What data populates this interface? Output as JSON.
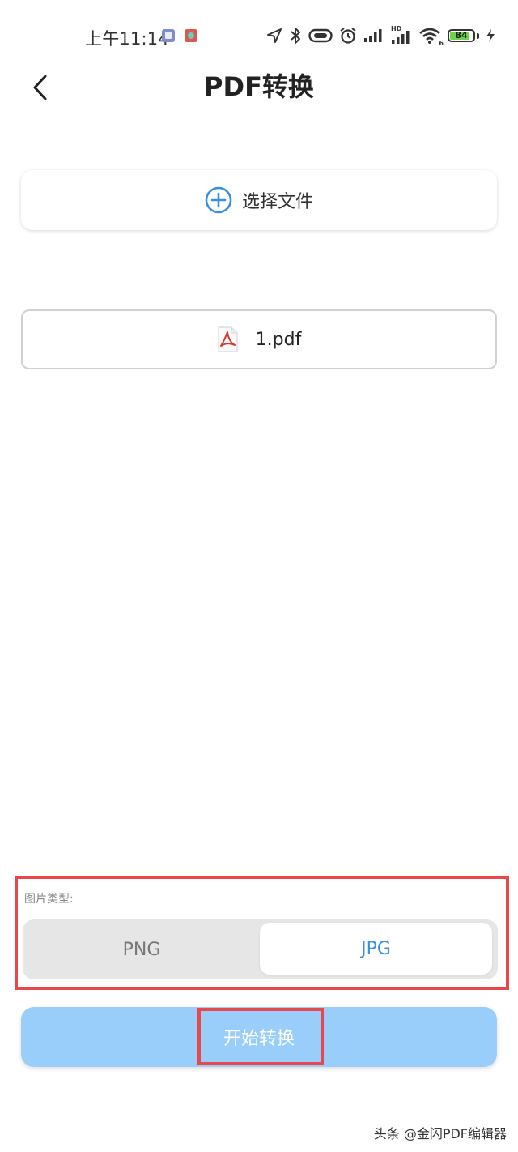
{
  "status_bar": {
    "time": "上午11:14",
    "signal_label": "HD",
    "wifi_label": "6",
    "battery_level": "84",
    "battery_fraction": 0.84
  },
  "header": {
    "title": "PDF转换",
    "back_icon": "chevron-left-icon"
  },
  "select_file": {
    "label": "选择文件",
    "icon": "plus-circle-icon",
    "accent_color": "#3a8fe0"
  },
  "file": {
    "name": "1.pdf",
    "icon": "pdf-file-icon"
  },
  "image_type": {
    "label": "图片类型:",
    "options": [
      "PNG",
      "JPG"
    ],
    "selected": "JPG"
  },
  "start_button": {
    "label": "开始转换",
    "color": "#99cefa"
  },
  "highlight_color": "#e8474b",
  "watermark": "头条 @金闪PDF编辑器"
}
